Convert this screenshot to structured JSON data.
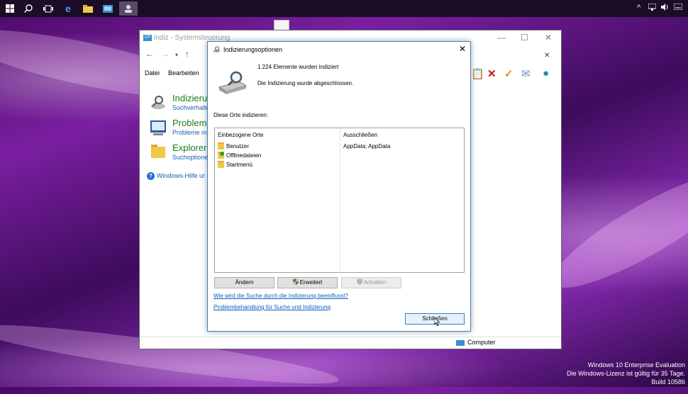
{
  "taskbar": {
    "icons": [
      "start-windows-icon",
      "search-icon",
      "task-view-icon",
      "edge-icon",
      "file-explorer-icon",
      "control-panel-icon",
      "user-accounts-icon"
    ]
  },
  "control_panel": {
    "title": "indiz - Systemsteuerung",
    "menu": {
      "file": "Datei",
      "edit": "Bearbeiten"
    },
    "items": [
      {
        "title": "Indizierun",
        "subtitle": "Suchverhalte"
      },
      {
        "title": "Problemb",
        "subtitle": "Probleme m"
      },
      {
        "title": "Explorer-",
        "subtitle": "Suchoptione"
      }
    ],
    "help_link": "Windows-Hilfe ur",
    "status_bar": "Computer"
  },
  "dialog": {
    "title": "Indizierungsoptionen",
    "indexed_count": "1.224 Elemente wurden indiziert",
    "indexing_status": "Die Indizierung wurde abgeschlossen.",
    "locations_label": "Diese Orte indizieren:",
    "table": {
      "col_included": "Einbezogene Orte",
      "col_excluded": "Ausschließen",
      "included": [
        "Benutzer",
        "Offlinedateien",
        "Startmenü"
      ],
      "excluded": "AppData; AppData"
    },
    "buttons": {
      "modify": "Ändern",
      "advanced": "Erweitert",
      "pause": "Anhalten",
      "close": "Schließen"
    },
    "links": {
      "how_affects": "Wie wird die Suche durch die Indizierung beeinflusst?",
      "troubleshoot": "Problembehandlung für Suche und Indizierung"
    }
  },
  "watermark": {
    "line1": "Windows 10 Enterprise Evaluation",
    "line2": "Die Windows-Lizenz ist gültig für 35 Tage.",
    "line3": "Build 10586"
  }
}
